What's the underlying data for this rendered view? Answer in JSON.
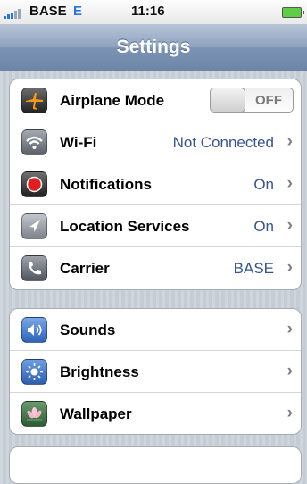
{
  "status_bar": {
    "carrier": "BASE",
    "network": "E",
    "time": "11:16",
    "network_color": "#2d74d6"
  },
  "nav": {
    "title": "Settings"
  },
  "settings_group_1": [
    {
      "label": "Airplane Mode",
      "icon": "airplane-icon",
      "toggle": "OFF"
    },
    {
      "label": "Wi-Fi",
      "icon": "wifi-icon",
      "value": "Not Connected"
    },
    {
      "label": "Notifications",
      "icon": "notifications-icon",
      "value": "On"
    },
    {
      "label": "Location Services",
      "icon": "location-icon",
      "value": "On"
    },
    {
      "label": "Carrier",
      "icon": "carrier-phone-icon",
      "value": "BASE"
    }
  ],
  "settings_group_2": [
    {
      "label": "Sounds",
      "icon": "speaker-icon"
    },
    {
      "label": "Brightness",
      "icon": "sun-icon"
    },
    {
      "label": "Wallpaper",
      "icon": "flower-icon"
    }
  ],
  "colors": {
    "value_text": "#385487",
    "nav_title": "#ffffff",
    "background": "#c5ccd4"
  }
}
